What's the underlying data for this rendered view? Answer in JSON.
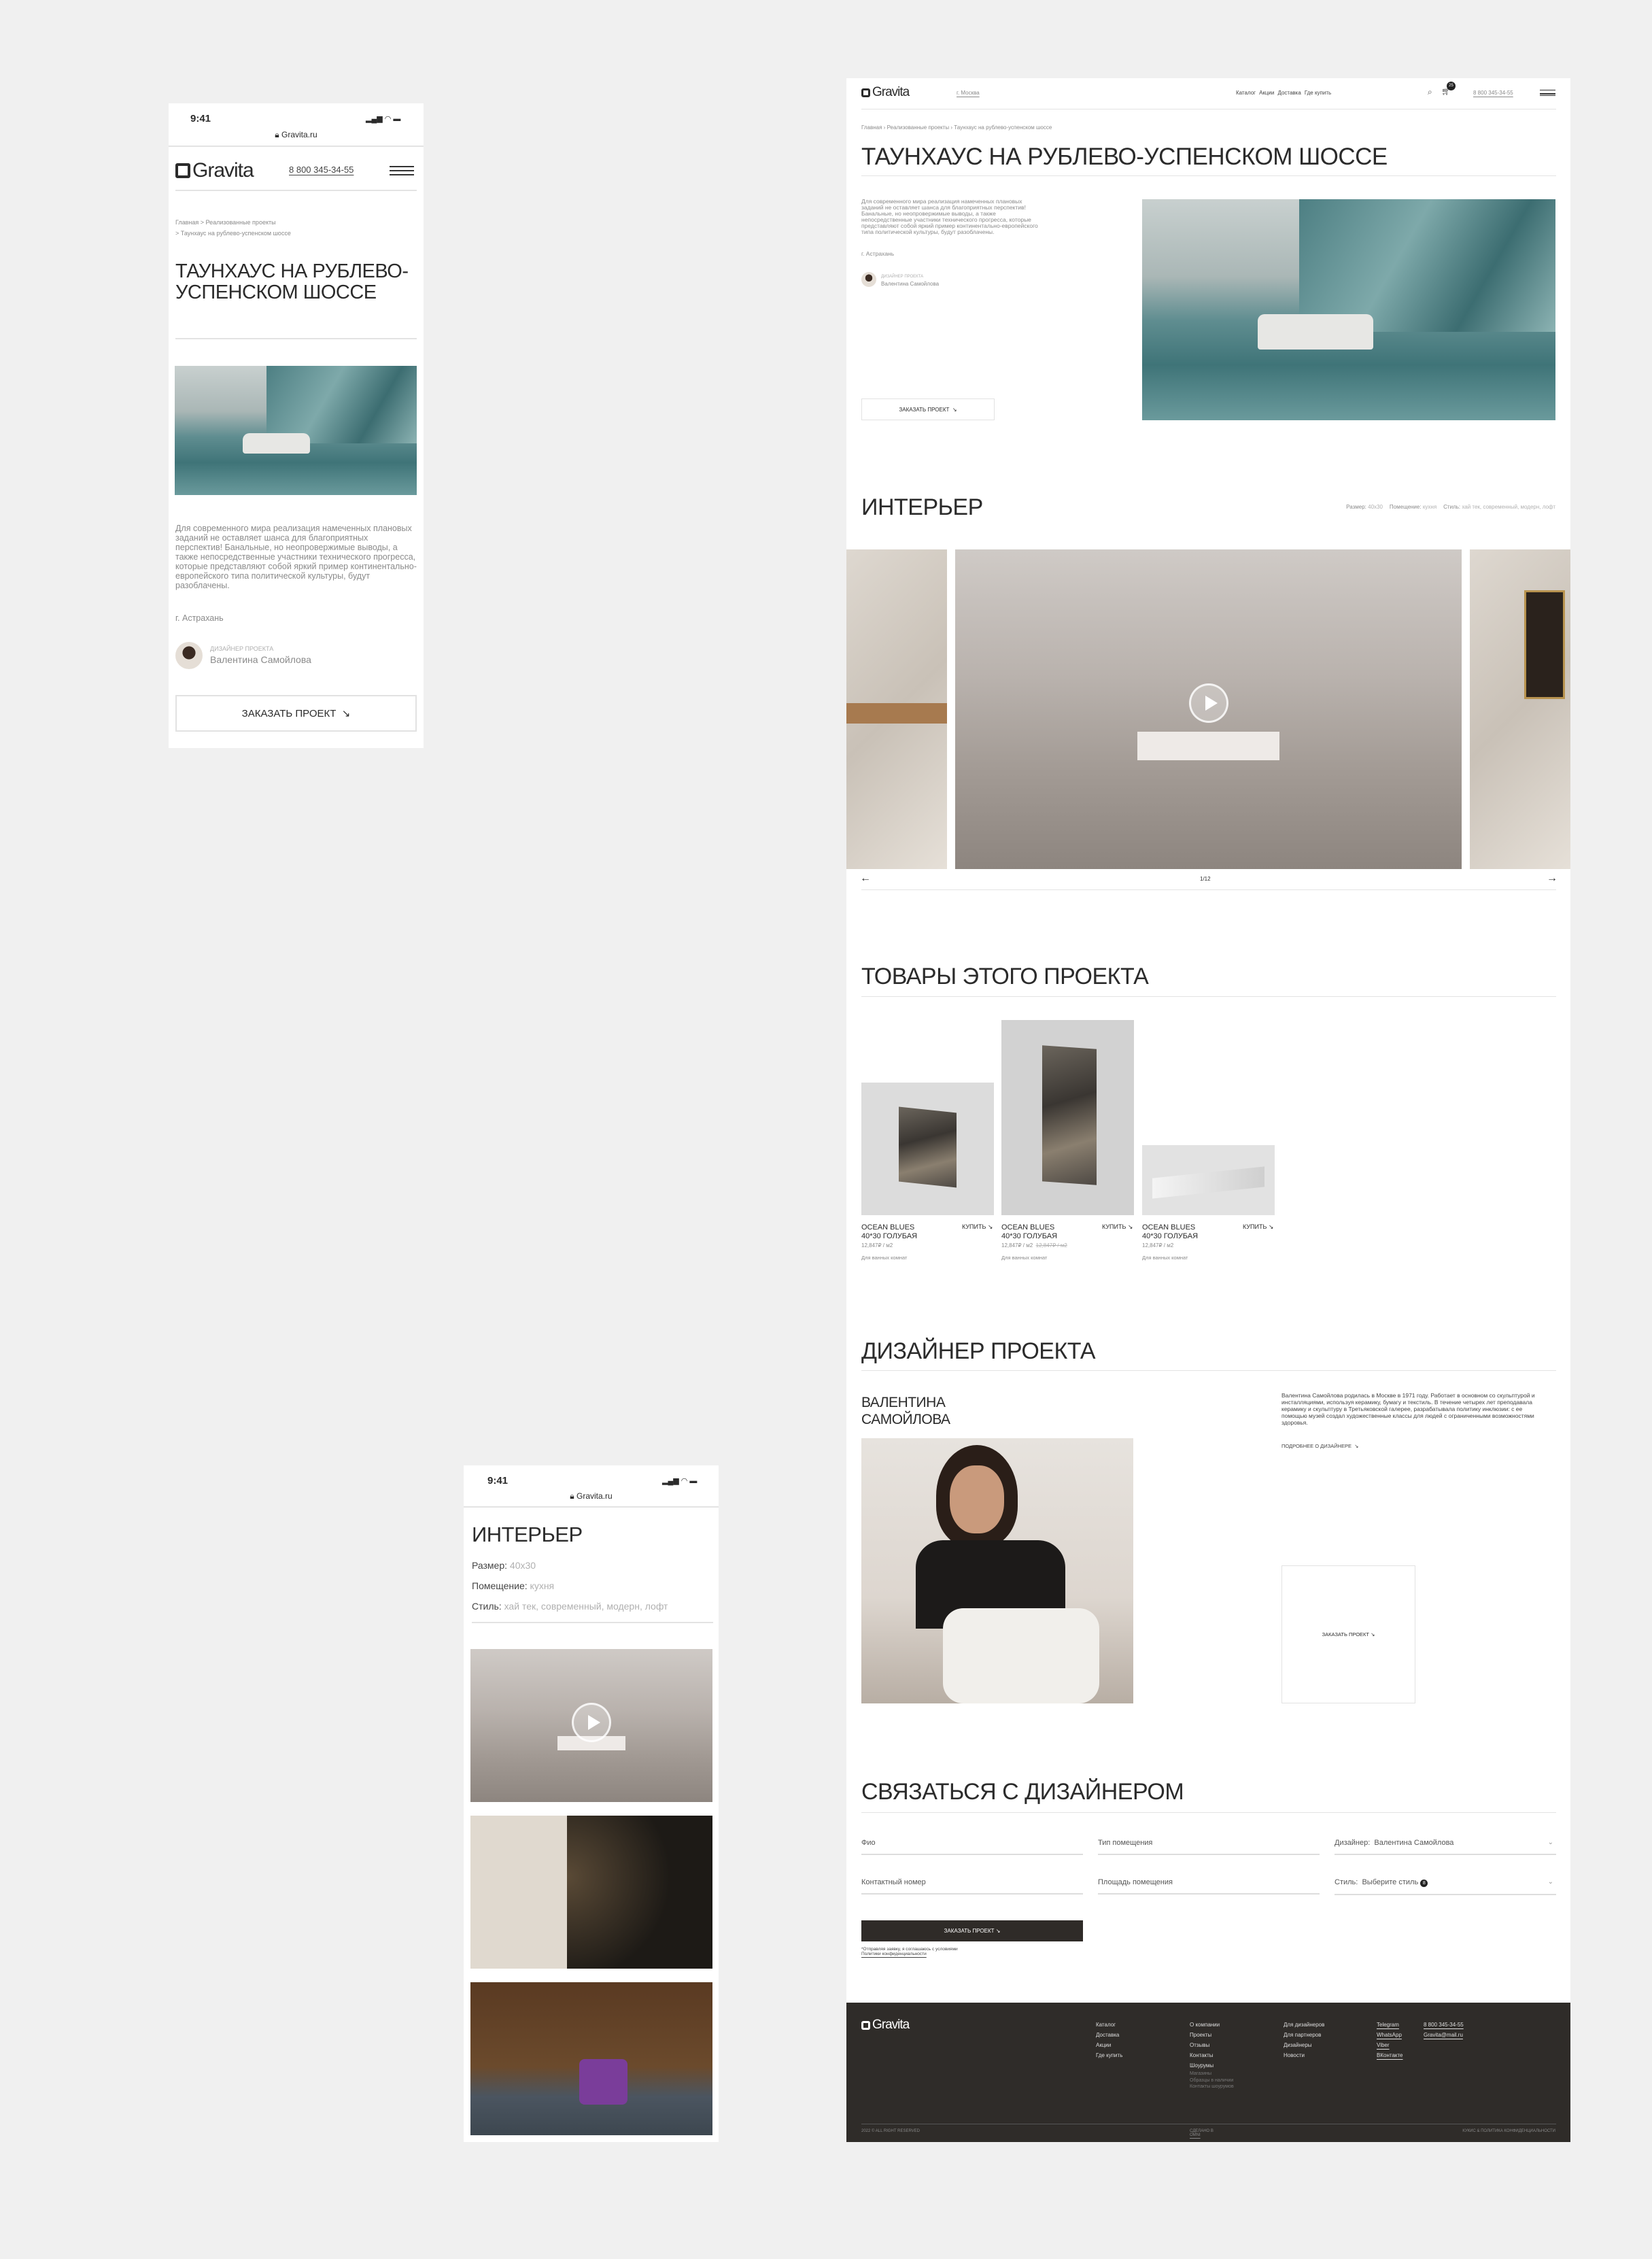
{
  "brand": "Gravita",
  "phone": "8 800 345-34-55",
  "mobile": {
    "time": "9:41",
    "url": "Gravita.ru"
  },
  "header": {
    "city": "г. Москва",
    "nav": [
      "Каталог",
      "Акции",
      "Доставка",
      "Где купить"
    ],
    "cart_count": "25"
  },
  "breadcrumb": [
    "Главная",
    "Реализованные проекты",
    "Таунхаус на рублево-успенском шоссе"
  ],
  "project": {
    "title": "ТАУНХАУС НА РУБЛЕВО-УСПЕНСКОМ ШОССЕ",
    "description": "Для современного мира реализация намеченных плановых заданий не оставляет шанса для благоприятных перспектив! Банальные, но неопровержимые выводы, а также непосредственные участники технического прогресса, которые представляют собой яркий пример континентально-европейского типа политической культуры, будут разоблачены.",
    "city": "г. Астрахань",
    "designer_label": "ДИЗАЙНЕР ПРОЕКТА",
    "designer_name": "Валентина Самойлова",
    "order_button": "ЗАКАЗАТЬ ПРОЕКТ"
  },
  "interior": {
    "title": "ИНТЕРЬЕР",
    "params": [
      {
        "label": "Размер:",
        "value": "40x30"
      },
      {
        "label": "Помещение:",
        "value": "кухня"
      },
      {
        "label": "Стиль:",
        "value": "хай тек, современный, модерн, лофт"
      }
    ],
    "counter": "1/12"
  },
  "products": {
    "title": "ТОВАРЫ ЭТОГО ПРОЕКТА",
    "buy_label": "КУПИТЬ",
    "items": [
      {
        "name": "OCEAN BLUES 40*30 ГОЛУБАЯ",
        "price": "12,847₽ / м2",
        "old_price": "",
        "category": "Для ванных комнат"
      },
      {
        "name": "OCEAN BLUES 40*30 ГОЛУБАЯ",
        "price": "12,847₽ / м2",
        "old_price": "12,847₽ / м2",
        "category": "Для ванных комнат"
      },
      {
        "name": "OCEAN BLUES 40*30 ГОЛУБАЯ",
        "price": "12,847₽ / м2",
        "old_price": "",
        "category": "Для ванных комнат"
      }
    ]
  },
  "designer": {
    "title": "ДИЗАЙНЕР ПРОЕКТА",
    "name_line1": "ВАЛЕНТИНА",
    "name_line2": "САМОЙЛОВА",
    "bio": "Валентина Самойлова родилась в Москве в 1971 году. Работает в основном со скульптурой и инсталляциями, используя керамику, бумагу и текстиль. В течение четырех лет преподавала керамику и скульптуру в Третьяковской галерее, разрабатывала политику инклюзии: с ее помощью музей создал художественные классы для людей с ограниченными возможностями здоровья.",
    "more_link": "ПОДРОБНЕЕ О ДИЗАЙНЕРЕ",
    "order_button": "ЗАКАЗАТЬ ПРОЕКТ"
  },
  "contact": {
    "title": "СВЯЗАТЬСЯ С ДИЗАЙНЕРОМ",
    "fields": {
      "name": "Фио",
      "room_type": "Тип помещения",
      "designer_label": "Дизайнер:",
      "designer_value": "Валентина Самойлова",
      "phone": "Контактный номер",
      "area": "Площадь помещения",
      "style_label": "Стиль:",
      "style_value": "Выберите стиль",
      "style_count": "8"
    },
    "submit": "ЗАКАЗАТЬ ПРОЕКТ",
    "note_line1": "*Отправляя заявку, я соглашаюсь с условиями",
    "note_line2": "Политики конфиденциальности"
  },
  "footer": {
    "col1": [
      "Каталог",
      "Доставка",
      "Акции",
      "Где купить"
    ],
    "col2": [
      "О компании",
      "Проекты",
      "Отзывы",
      "Контакты",
      "Шоурумы"
    ],
    "col2_sub": [
      "Магазины",
      "Образцы в наличии",
      "Контакты шоурумов"
    ],
    "col3": [
      "Для дизайнеров",
      "Для партнеров",
      "Дизайнеры",
      "Новости"
    ],
    "social": [
      "Telegram",
      "WhatsApp",
      "Viber",
      "ВКонтакте"
    ],
    "phone": "8 800 345-34-55",
    "email": "Gravita@mail.ru",
    "copyright": "2022 © ALL RIGHT RESERVED",
    "made_by_prefix": "СДЕЛАНО В",
    "made_by": "OMNI",
    "policy": "КУКИС & ПОЛИТИКА КОНФИДЕНЦИАЛЬНОСТИ"
  }
}
